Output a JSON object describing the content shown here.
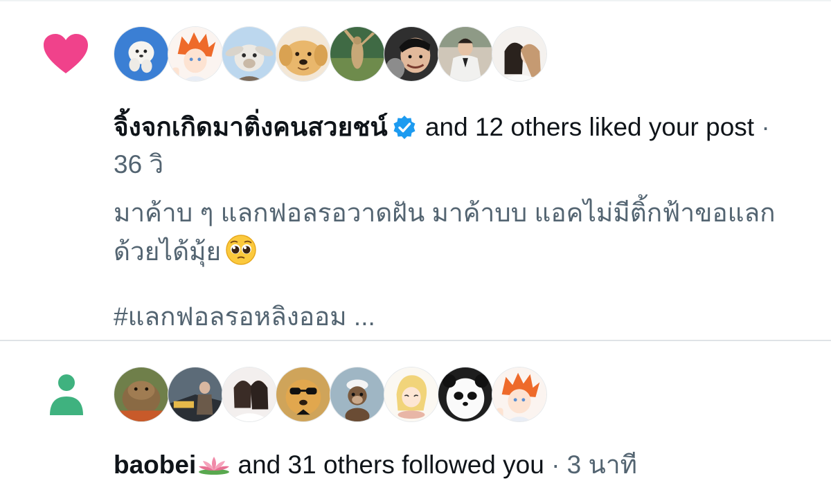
{
  "like_notification": {
    "icon": "heart-icon",
    "icon_color": "#f0428b",
    "avatars": [
      "avatar-white-puppy",
      "avatar-orange-hair-anime-boy",
      "avatar-fluffy-goat",
      "avatar-golden-puppy",
      "avatar-meerkat",
      "avatar-smiling-person",
      "avatar-groom-in-suit",
      "avatar-couple-portrait"
    ],
    "actor": "จิ้งจกเกิดมาติ่งคนสวยชน์",
    "verified_icon": "verified-badge-icon",
    "verified_color": "#1d9bf0",
    "action": "and 12 others liked your post",
    "separator": "·",
    "time": "36 วิ",
    "post_text": "มาค้าบ ๆ แลกฟอลรอวาดฝัน มาค้าบบ แอคไม่มีติ้กฟ้าขอแลก ด้วยได้มุ้ย",
    "post_emoji": "pleading-face-emoji",
    "post_hashtag": "#แลกฟอลรอหลิงออม ..."
  },
  "follow_notification": {
    "icon": "person-icon",
    "icon_color": "#3fb27f",
    "avatars": [
      "avatar-capybara",
      "avatar-car-and-people",
      "avatar-two-women",
      "avatar-dog-sunglasses",
      "avatar-otter",
      "avatar-blonde-anime-girl",
      "avatar-panda-bear",
      "avatar-orange-hair-anime-boy"
    ],
    "actor": "baobei",
    "actor_emoji": "lotus-emoji",
    "action": "and 31 others followed you",
    "separator": "·",
    "time": "3 นาที"
  }
}
